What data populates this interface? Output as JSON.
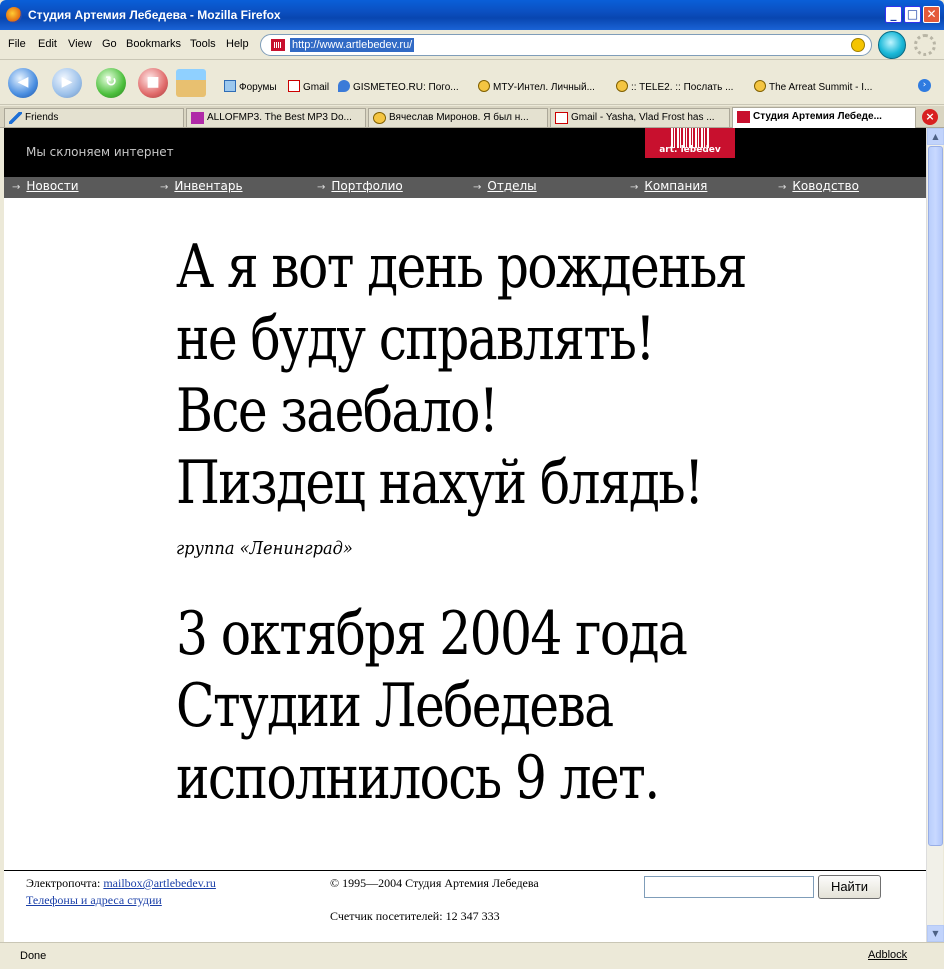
{
  "window": {
    "title": "Студия Артемия Лебедева - Mozilla Firefox",
    "minimize": "_",
    "maximize": "□",
    "close": "✕"
  },
  "menu": {
    "items": [
      "File",
      "Edit",
      "View",
      "Go",
      "Bookmarks",
      "Tools",
      "Help"
    ]
  },
  "urlbar": {
    "url": "http://www.artlebedev.ru/"
  },
  "bookmarks": [
    {
      "label": "Форумы",
      "icon": "folder-icon"
    },
    {
      "label": "Gmail",
      "icon": "gmail-icon"
    },
    {
      "label": "GISMETEO.RU: Пого...",
      "icon": "drop-icon"
    },
    {
      "label": "МТУ-Интел. Личный...",
      "icon": "pin-icon"
    },
    {
      "label": ":: TELE2. :: Послать ...",
      "icon": "pin-icon"
    },
    {
      "label": "The Arreat Summit - I...",
      "icon": "pin-icon"
    }
  ],
  "tabs": [
    {
      "label": "Friends",
      "icon": "pencil-icon"
    },
    {
      "label": "ALLOFMP3. The Best MP3 Do...",
      "icon": "mp3-icon"
    },
    {
      "label": "Вячеслав Миронов. Я был н...",
      "icon": "pin-icon"
    },
    {
      "label": "Gmail - Yasha, Vlad Frost has ...",
      "icon": "gmail-icon"
    },
    {
      "label": "Студия Артемия Лебеде...",
      "icon": "lebedev-icon"
    }
  ],
  "site": {
    "tagline": "Мы склоняем интернет",
    "logo_text": "art. lebedev",
    "nav": [
      "Новости",
      "Инвентарь",
      "Портфолио",
      "Отделы",
      "Компания",
      "Ководство"
    ]
  },
  "content": {
    "quote_lines": [
      "А я вот день рожденья",
      "не буду справлять!",
      "Все заебало!",
      "Пиздец нахуй блядь!"
    ],
    "attribution": "группа «Ленинград»",
    "announce_lines": [
      "3 октября 2004 года",
      "Студии Лебедева",
      "исполнилось 9 лет."
    ]
  },
  "footer": {
    "email_label": "Электропочта:",
    "email": "mailbox@artlebedev.ru",
    "contacts_link": "Телефоны и адреса студии",
    "copyright": "© 1995—2004 Студия Артемия Лебедева",
    "counter": "Счетчик посетителей: 12 347 333",
    "search_button": "Найти",
    "search_value": ""
  },
  "status": {
    "text": "Done",
    "adblock": "Adblock"
  },
  "colors": {
    "brand_red": "#c8102e",
    "header_black": "#000000",
    "nav_gray": "#5a5a5a"
  }
}
